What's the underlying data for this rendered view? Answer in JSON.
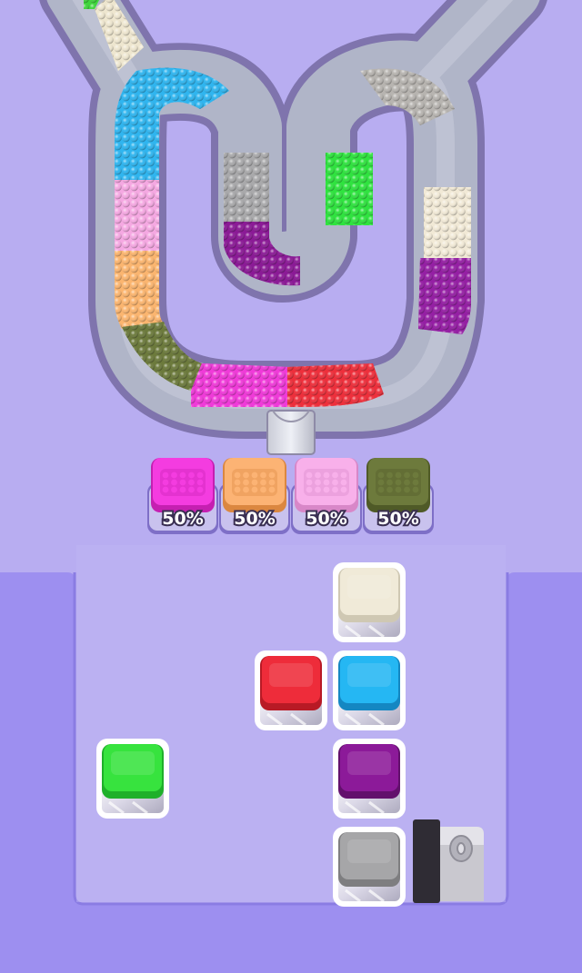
{
  "colors": {
    "background": "#b8adf1",
    "board": "#9d8ff0",
    "board_edge": "#8a7ce3",
    "track": "#b0b5c8",
    "track_rim": "#7f74ad"
  },
  "conveyor_segments": [
    {
      "id": "seg-green-top",
      "color": "#3ed63b"
    },
    {
      "id": "seg-cream-top",
      "color": "#eee6cf"
    },
    {
      "id": "seg-cyan",
      "color": "#2fb5ef"
    },
    {
      "id": "seg-pink",
      "color": "#f5a8e2"
    },
    {
      "id": "seg-orange",
      "color": "#fbb56f"
    },
    {
      "id": "seg-olive",
      "color": "#6c7a3c"
    },
    {
      "id": "seg-magenta",
      "color": "#f03ad9"
    },
    {
      "id": "seg-red",
      "color": "#ee2f3b"
    },
    {
      "id": "seg-gray-inner",
      "color": "#a9a9ab"
    },
    {
      "id": "seg-purple-inner",
      "color": "#8b1a96"
    },
    {
      "id": "seg-green-inner",
      "color": "#2fe33f"
    },
    {
      "id": "seg-gray-right",
      "color": "#b7b4b0"
    },
    {
      "id": "seg-cream-right",
      "color": "#f1e9d6"
    },
    {
      "id": "seg-purple-right",
      "color": "#951fa4"
    }
  ],
  "collection_cups": [
    {
      "color": "#f43ce0",
      "dark": "#c51fb1",
      "label": "50%"
    },
    {
      "color": "#fcb374",
      "dark": "#db8740",
      "label": "50%"
    },
    {
      "color": "#f8b0ea",
      "dark": "#d887c8",
      "label": "50%"
    },
    {
      "color": "#6d7a3c",
      "dark": "#4f5a27",
      "label": "50%"
    }
  ],
  "tray_cups": [
    {
      "id": "cup-cream",
      "color": "#f0ead8",
      "dark": "#cfc8b3"
    },
    {
      "id": "cup-red",
      "color": "#ee2c3a",
      "dark": "#b81a25"
    },
    {
      "id": "cup-cyan",
      "color": "#25b7f3",
      "dark": "#1487c2"
    },
    {
      "id": "cup-green",
      "color": "#37e33e",
      "dark": "#1fb02a"
    },
    {
      "id": "cup-purple",
      "color": "#8c1a99",
      "dark": "#62106c"
    },
    {
      "id": "cup-gray",
      "color": "#a6a6a8",
      "dark": "#7e7e80"
    }
  ],
  "icons": {
    "feeder": "feeder-machine-icon",
    "nozzle": "dispenser-nozzle-icon"
  }
}
